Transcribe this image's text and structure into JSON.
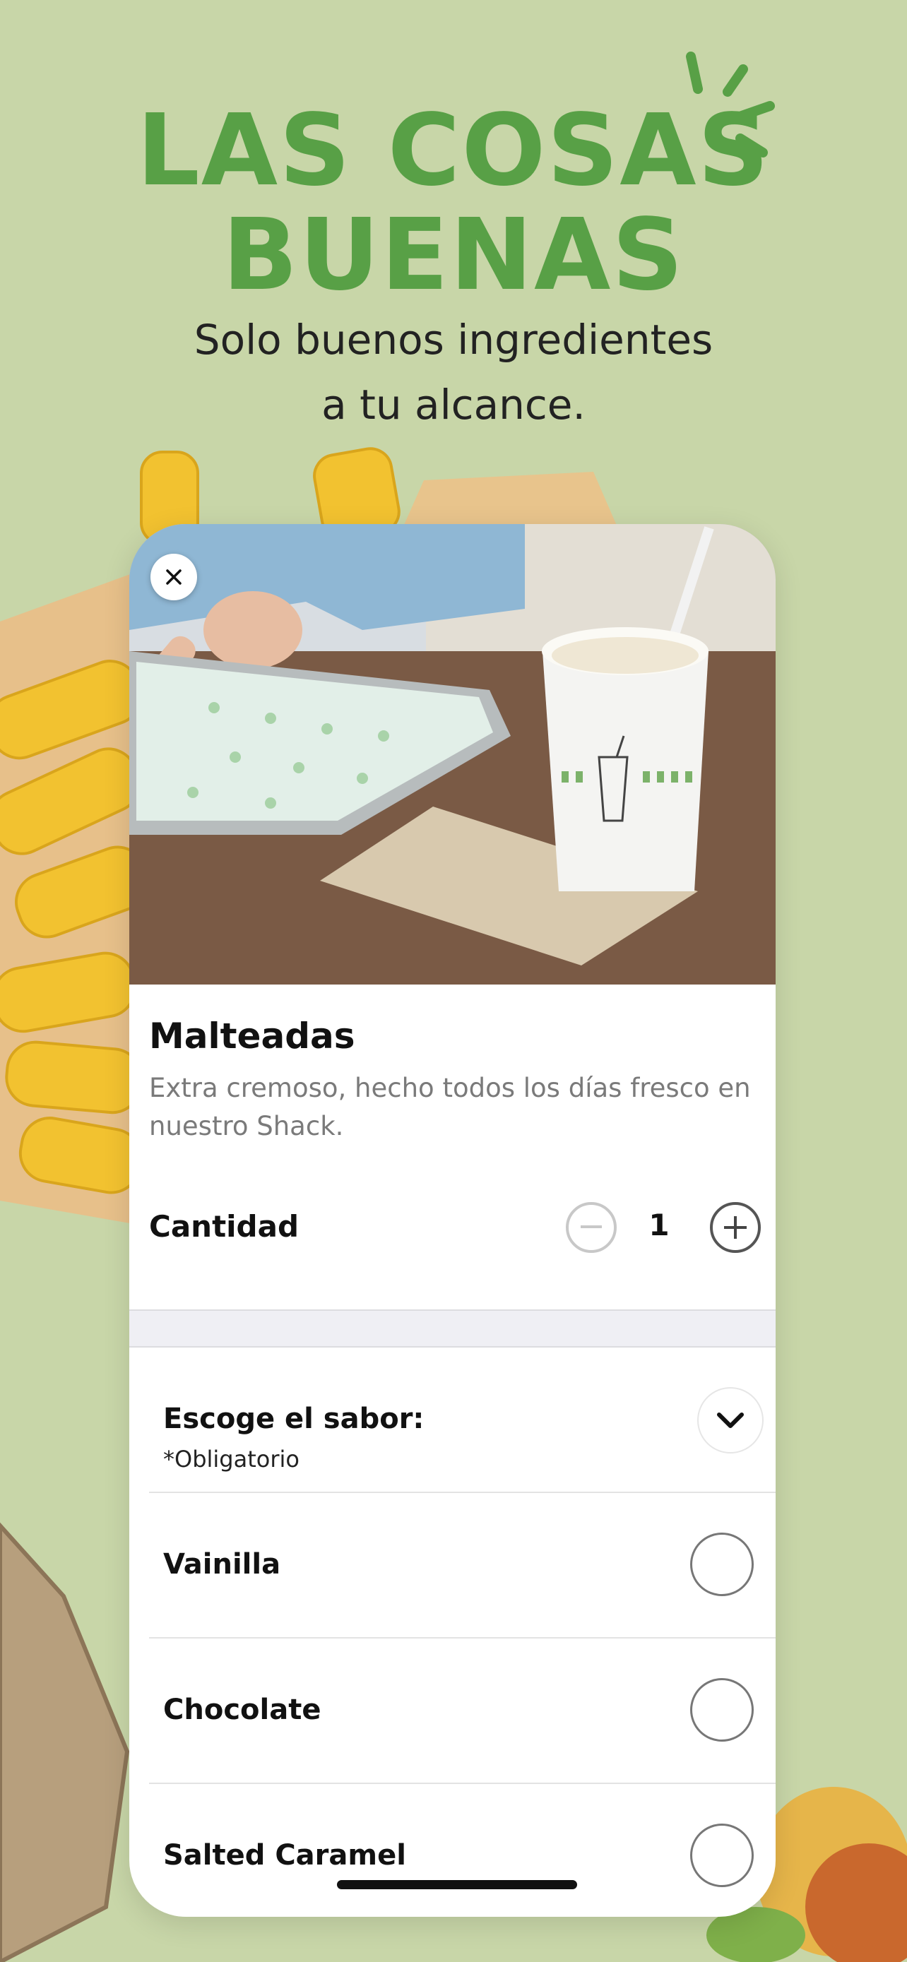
{
  "headline": {
    "line1": "LAS COSAS",
    "line2": "BUENAS",
    "subtitle_line1": "Solo buenos ingredientes",
    "subtitle_line2": "a tu alcance."
  },
  "card": {
    "close_icon": "close-icon",
    "title": "Malteadas",
    "description": "Extra cremoso, hecho todos los días fresco en nuestro Shack.",
    "quantity": {
      "label": "Cantidad",
      "value": "1",
      "minus_icon": "minus-circle-icon",
      "plus_icon": "plus-circle-icon"
    },
    "flavor_section": {
      "title": "Escoge el sabor:",
      "required": "*Obligatorio",
      "toggle_icon": "chevron-down-icon",
      "options": [
        {
          "label": "Vainilla"
        },
        {
          "label": "Chocolate"
        },
        {
          "label": "Salted Caramel"
        }
      ]
    }
  },
  "colors": {
    "background": "#c8d6a8",
    "headline_green": "#58a046",
    "card": "#ffffff"
  }
}
